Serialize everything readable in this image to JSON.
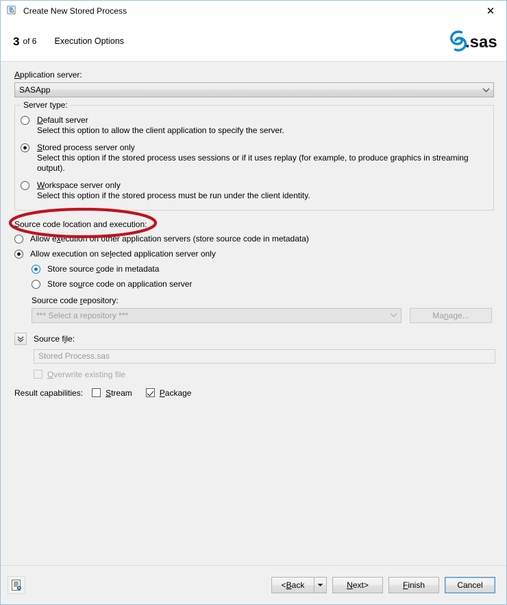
{
  "window": {
    "title": "Create New Stored Process",
    "icon": "stored-process-icon",
    "close_label": "✕"
  },
  "header": {
    "step_number": "3",
    "step_of": "of 6",
    "step_title": "Execution Options",
    "logo_text": "sas.",
    "logo_color": "#0089cf"
  },
  "application_server": {
    "label": "Application server:",
    "label_mnemonic": "A",
    "value": "SASApp",
    "chevron": "chevron-down-icon"
  },
  "server_type": {
    "group_label": "Server type:",
    "options": [
      {
        "title": "Default server",
        "mnemonic": "D",
        "description": "Select this option to allow the client application to specify the server.",
        "selected": false
      },
      {
        "title": "Stored process server only",
        "mnemonic": "S",
        "description": "Select this option if the stored process uses sessions or if it uses replay (for example, to produce graphics in streaming output).",
        "selected": true
      },
      {
        "title": "Workspace server only",
        "mnemonic": "W",
        "description": "Select this option if the stored process must be run under the client identity.",
        "selected": false
      }
    ]
  },
  "source_code": {
    "section_label": "Source code location and execution:",
    "options": [
      {
        "label": "Allow execution on other application servers (store source code in metadata)",
        "selected": false,
        "accent": false
      },
      {
        "label": "Allow execution on selected application server only",
        "selected": true,
        "accent": false
      }
    ],
    "sub_options": [
      {
        "label": "Store source code in metadata",
        "selected": true,
        "accent": true
      },
      {
        "label": "Store source code on application server",
        "selected": false,
        "accent": false
      }
    ],
    "repository": {
      "label": "Source code repository:",
      "value": "*** Select a repository ***",
      "disabled": true,
      "manage_button": "Manage...",
      "manage_disabled": true,
      "chevron": "chevron-down-icon"
    }
  },
  "source_file": {
    "expander_icon": "double-chevron-down-icon",
    "label": "Source file:",
    "value": "Stored Process.sas",
    "overwrite": {
      "label": "Overwrite existing file",
      "checked": false,
      "disabled": true
    }
  },
  "result_capabilities": {
    "label": "Result capabilities:",
    "items": [
      {
        "label": "Stream",
        "checked": false
      },
      {
        "label": "Package",
        "checked": true
      }
    ]
  },
  "footer": {
    "help_icon": "document-properties-icon",
    "buttons": [
      {
        "label": "<Back",
        "has_dropdown": true,
        "focused": false
      },
      {
        "label": "Next>",
        "has_dropdown": false,
        "focused": false
      },
      {
        "label": "Finish",
        "has_dropdown": false,
        "focused": false
      },
      {
        "label": "Cancel",
        "has_dropdown": false,
        "focused": true
      }
    ]
  },
  "annotation": {
    "type": "ellipse-highlight",
    "color": "#c1121f",
    "target": "stored-process-server-only-option"
  }
}
